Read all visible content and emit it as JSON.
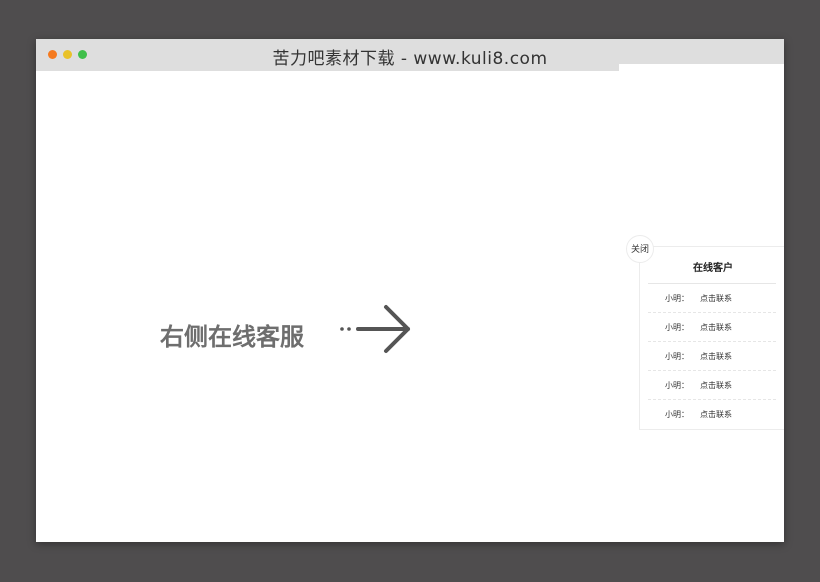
{
  "window": {
    "title": "苦力吧素材下载 - www.kuli8.com"
  },
  "hero": {
    "text": "右侧在线客服"
  },
  "service_panel": {
    "close_label": "关闭",
    "title": "在线客户",
    "items": [
      {
        "name": "小明：",
        "link": "点击联系"
      },
      {
        "name": "小明：",
        "link": "点击联系"
      },
      {
        "name": "小明：",
        "link": "点击联系"
      },
      {
        "name": "小明：",
        "link": "点击联系"
      },
      {
        "name": "小明：",
        "link": "点击联系"
      }
    ]
  },
  "colors": {
    "background": "#4f4d4e",
    "titlebar": "#dedede",
    "dot_red": "#f57a1f",
    "dot_yellow": "#e9c229",
    "dot_green": "#3fbf4a",
    "hero_text": "#6e6e6e"
  },
  "icons": {
    "hero_arrow": "arrow-right-icon"
  }
}
